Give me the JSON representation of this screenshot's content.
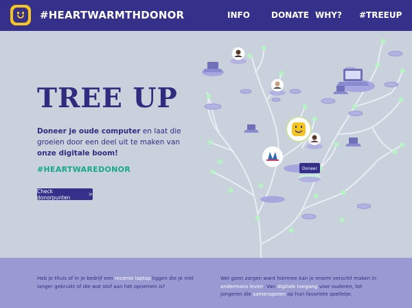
{
  "header": {
    "brand": "#HEARTWARMTHDONOR",
    "nav": [
      "INFO",
      "DONATE",
      "WHY?",
      "#TREEUP"
    ]
  },
  "hero": {
    "title": "TREE UP",
    "intro_bold_1": "Doneer je oude computer",
    "intro_text_1": " en laat die groeien door een deel uit te maken van ",
    "intro_bold_2": "onze digitale boom!",
    "hashtag": "#HEARTWAREDONOR",
    "cta_label": "Check donorpunten",
    "cta_arrow": ">",
    "donor_badge": "Doneer"
  },
  "footer": {
    "left_1": "Heb je thuis of in je bedrijf een ",
    "left_hl": "recente laptop",
    "left_2": " liggen die je niet langer gebruikt of die wat stof aan het opnemen is?",
    "right_1": "Wel geen zorgen want hiermee kan je enorm verschil maken in ",
    "right_hl1": "andermans leven",
    "right_2": ". Van ",
    "right_hl2": "digitale toegang",
    "right_3": " voor ouderen, tot jongeren die ",
    "right_hl3": "samenspelen",
    "right_4": " op hun favoriete spelletje."
  },
  "colors": {
    "navbar": "#35318a",
    "accent_green": "#16a78a",
    "logo_yellow": "#f4c522",
    "background": "#c9d2dc",
    "footer": "#9a9ad3"
  }
}
